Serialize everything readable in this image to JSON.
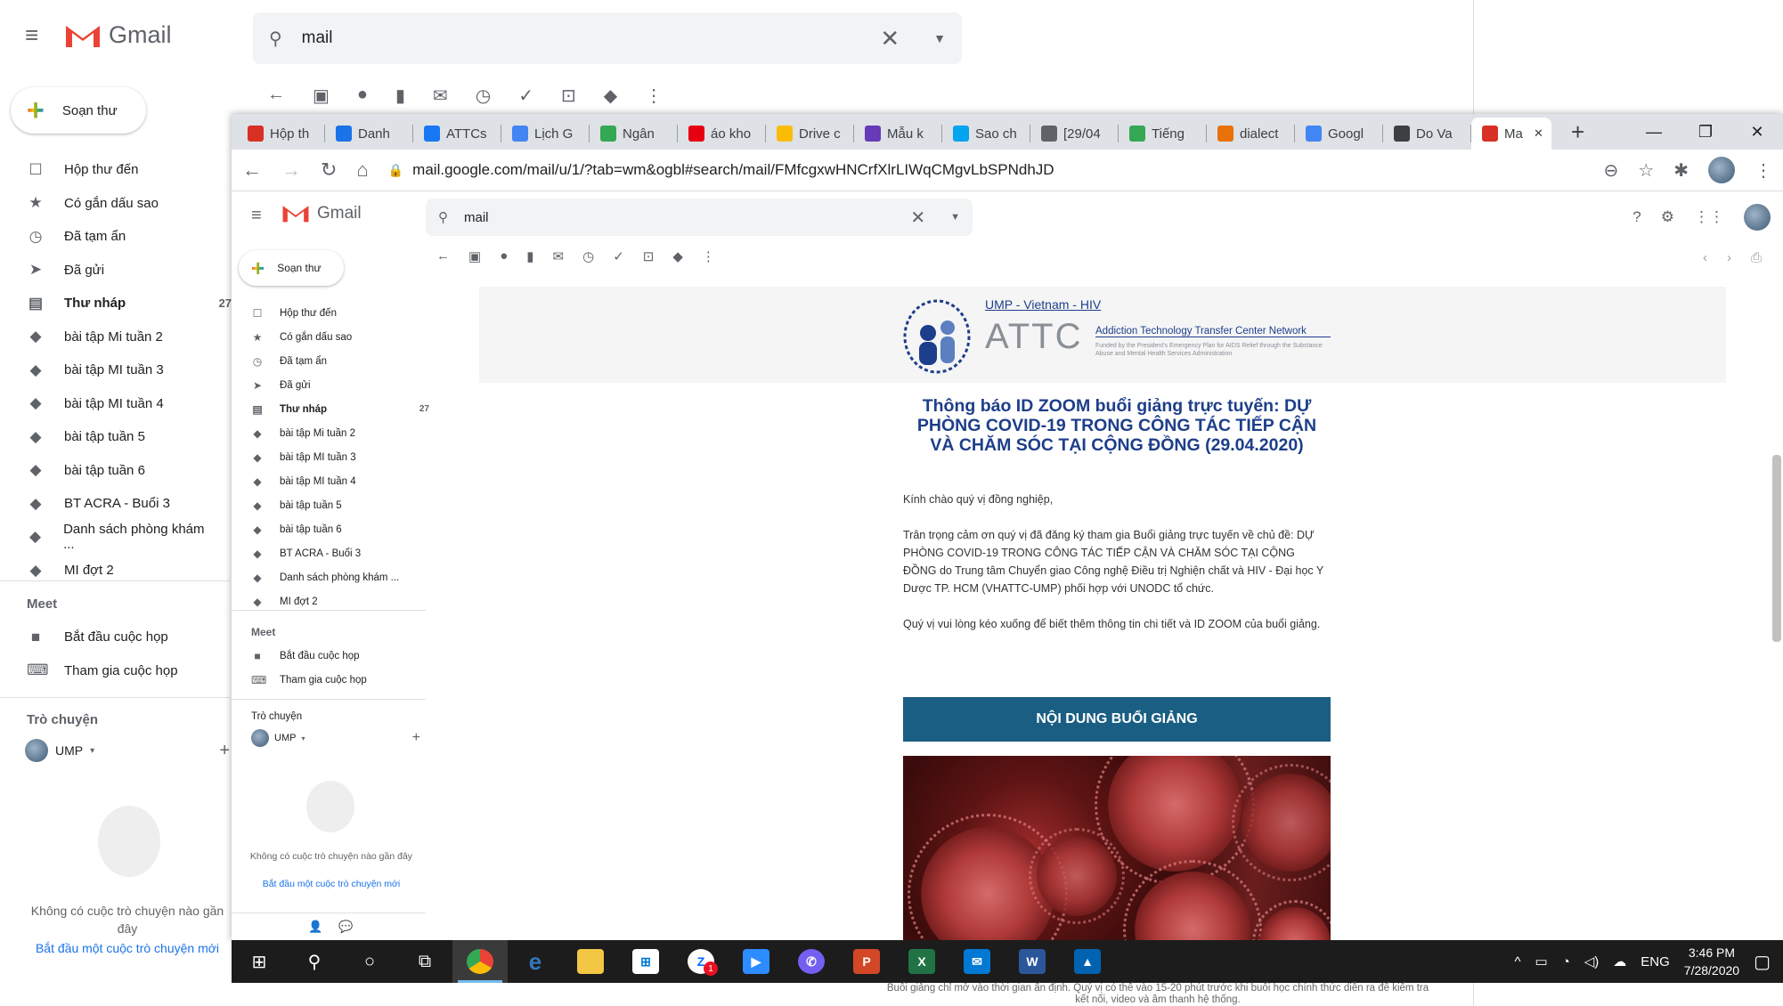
{
  "bg_gmail": {
    "app_name": "Gmail",
    "search_value": "mail",
    "compose_label": "Soạn thư",
    "nav": [
      {
        "label": "Hộp thư đến",
        "icon": "inbox-icon",
        "count": ""
      },
      {
        "label": "Có gắn dấu sao",
        "icon": "star-icon",
        "count": ""
      },
      {
        "label": "Đã tạm ẩn",
        "icon": "clock-icon",
        "count": ""
      },
      {
        "label": "Đã gửi",
        "icon": "send-icon",
        "count": ""
      },
      {
        "label": "Thư nháp",
        "icon": "draft-icon",
        "count": "27"
      },
      {
        "label": "bài tập Mi tuần 2",
        "icon": "label-icon",
        "count": ""
      },
      {
        "label": "bài tập MI tuần 3",
        "icon": "label-icon",
        "count": ""
      },
      {
        "label": "bài tập MI tuần 4",
        "icon": "label-icon",
        "count": ""
      },
      {
        "label": "bài tập tuần 5",
        "icon": "label-icon",
        "count": ""
      },
      {
        "label": "bài tập tuần 6",
        "icon": "label-icon",
        "count": ""
      },
      {
        "label": "BT ACRA - Buổi 3",
        "icon": "label-icon",
        "count": ""
      },
      {
        "label": "Danh sách phòng khám ...",
        "icon": "label-icon",
        "count": ""
      },
      {
        "label": "MI đợt 2",
        "icon": "label-icon",
        "count": ""
      }
    ],
    "meet_title": "Meet",
    "meet_items": [
      "Bắt đầu cuộc họp",
      "Tham gia cuộc họp"
    ],
    "chat_title": "Trò chuyện",
    "chat_user": "UMP",
    "no_chat": "Không có cuộc trò chuyện nào gần đây",
    "start_chat": "Bắt đầu một cuộc trò chuyện mới"
  },
  "browser": {
    "tabs": [
      {
        "label": "Hộp th",
        "icon": "gmail-icon",
        "color": "#d93025"
      },
      {
        "label": "Danh",
        "icon": "account-icon",
        "color": "#1a73e8"
      },
      {
        "label": "ATTCs",
        "icon": "facebook-icon",
        "color": "#1877f2"
      },
      {
        "label": "Lịch G",
        "icon": "calendar-icon",
        "color": "#4285f4"
      },
      {
        "label": "Ngân",
        "icon": "shield-icon",
        "color": "#34a853"
      },
      {
        "label": "áo kho",
        "icon": "uniqlo-icon",
        "color": "#e60012"
      },
      {
        "label": "Drive c",
        "icon": "drive-icon",
        "color": "#fbbc04"
      },
      {
        "label": "Mẫu k",
        "icon": "forms-icon",
        "color": "#673ab7"
      },
      {
        "label": "Sao ch",
        "icon": "windows-icon",
        "color": "#00a4ef"
      },
      {
        "label": "[29/04",
        "icon": "globe-icon",
        "color": "#5f6368"
      },
      {
        "label": "Tiếng",
        "icon": "image-icon",
        "color": "#34a853"
      },
      {
        "label": "dialect",
        "icon": "dialect-icon",
        "color": "#e8710a"
      },
      {
        "label": "Googl",
        "icon": "google-search-icon",
        "color": "#4285f4"
      },
      {
        "label": "Do Va",
        "icon": "globe-icon",
        "color": "#3c4043"
      },
      {
        "label": "Ma",
        "icon": "gmail-icon",
        "color": "#d93025"
      }
    ],
    "url": "mail.google.com/mail/u/1/?tab=wm&ogbl#search/mail/FMfcgxwHNCrfXlrLIWqCMgvLbSPNdhJD"
  },
  "inner_gmail": {
    "app_name": "Gmail",
    "search_value": "mail",
    "compose_label": "Soạn thư",
    "meet_title": "Meet",
    "meet_items": [
      "Bắt đầu cuộc họp",
      "Tham gia cuộc họp"
    ],
    "chat_title": "Trò chuyện",
    "chat_user": "UMP",
    "no_chat": "Không có cuộc trò chuyện nào gần đây",
    "start_chat": "Bắt đầu một cuộc trò chuyện mới"
  },
  "email": {
    "logo_top": "UMP - Vietnam - HIV",
    "logo_name": "ATTC",
    "logo_network": "Addiction Technology Transfer Center Network",
    "logo_sub": "Funded by the President's Emergency Plan for AIDS Relief through the Substance Abuse and Mental Health Services Administration",
    "title": "Thông báo ID ZOOM buổi giảng trực tuyến: DỰ PHÒNG COVID-19 TRONG CÔNG TÁC TIẾP CẬN VÀ CHĂM SÓC TẠI CỘNG ĐỒNG (29.04.2020)",
    "greeting": "Kính chào quý vị đồng nghiệp,",
    "para1": "Trân trọng cảm ơn quý vị đã đăng ký tham gia Buổi giảng trực tuyến về chủ đề: DỰ PHÒNG COVID-19 TRONG CÔNG TÁC TIẾP CẬN VÀ CHĂM SÓC TẠI CỘNG ĐỒNG do Trung tâm Chuyển giao Công nghệ Điều trị Nghiện chất và HIV - Đại học Y Dược TP. HCM (VHATTC-UMP) phối hợp với UNODC tổ chức.",
    "para2": "Quý vị vui lòng kéo xuống để biết thêm thông tin chi tiết và ID ZOOM của buổi giảng.",
    "section_bar": "NỘI DUNG BUỔI GIẢNG",
    "below_text": "Buổi giảng chỉ mở vào thời gian ấn định. Quý vị có thể vào 15-20 phút trước khi buổi học chính thức diễn ra để kiểm tra kết nối, video và âm thanh hệ thống."
  },
  "taskbar": {
    "lang": "ENG",
    "time": "3:46 PM",
    "date": "7/28/2020",
    "zalo_badge": "1"
  }
}
